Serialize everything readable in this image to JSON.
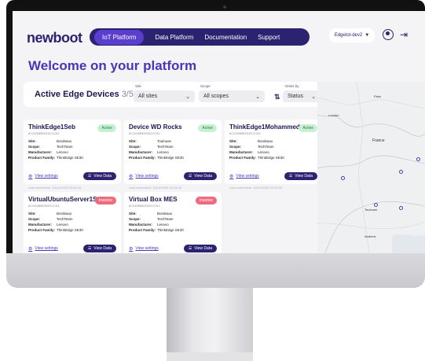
{
  "header": {
    "logo": "newboot",
    "nav": [
      "IoT Platform",
      "Data Platform",
      "Documentation",
      "Support"
    ],
    "env_select": "Edgelot-dev2",
    "env_chevron": "▼"
  },
  "welcome": "Welcome on your platform",
  "panel": {
    "title": "Active Edge Devices",
    "count": "3/5",
    "filters": {
      "site": {
        "label": "Site",
        "value": "All sites"
      },
      "scope": {
        "label": "Scope",
        "value": "All scopes"
      },
      "order": {
        "label": "Order by",
        "value": "Status"
      }
    }
  },
  "card_labels": {
    "site": "Site:",
    "scope": "Scope:",
    "manufacturer": "Manufacturer:",
    "product_family": "Product Family:",
    "view_settings": "View settings",
    "view_data": "View Data"
  },
  "devices": [
    {
      "name": "ThinkEdge1Seb",
      "id": "6C2409BEE03CCC51",
      "status": "Active",
      "site": "Bordeaux",
      "scope": "TechTeam",
      "manufacturer": "Lenovo",
      "product_family": "ThinkEdge SE30",
      "last_connection": "Last connection: 10/12/2023 20:19:43"
    },
    {
      "name": "Device WD Rocks",
      "id": "6C2409BEE03CCC51",
      "status": "Active",
      "site": "Toulouse",
      "scope": "TechTeam",
      "manufacturer": "Lenovo",
      "product_family": "ThinkEdge SE30",
      "last_connection": "Last connection: 10/12/2023 20:19:43"
    },
    {
      "name": "ThinkEdge1Mohammed",
      "id": "6C2409BEE03CCC51",
      "status": "Active",
      "site": "Bordeaux",
      "scope": "TechTeam",
      "manufacturer": "Lenovo",
      "product_family": "ThinkEdge SE30",
      "last_connection": "Last connection: 10/12/2023 20:19:43"
    },
    {
      "name": "VirtualUbuntuServer1Seb",
      "id": "6C2409BEE03CCC51",
      "status": "Inactive",
      "site": "Bordeaux",
      "scope": "TechTeam",
      "manufacturer": "Lenovo",
      "product_family": "ThinkEdge SE30"
    },
    {
      "name": "Virtual Box MES",
      "id": "6C2409BEE03CCC51",
      "status": "Inactive",
      "site": "Bordeaux",
      "scope": "TechTeam",
      "manufacturer": "Lenovo",
      "product_family": "ThinkEdge SE30"
    }
  ],
  "map": {
    "labels": [
      "Paris",
      "London",
      "France",
      "Toulouse",
      "Andorra"
    ]
  },
  "colors": {
    "brand": "#2c2370",
    "accent": "#4b34b8",
    "active_badge": "#c9f0d4",
    "inactive_badge": "#ef6a7c"
  },
  "icons": [
    "user-icon",
    "logout-icon",
    "gear-icon",
    "list-icon",
    "chevron-down-icon",
    "sort-icon",
    "map-pin-icon"
  ]
}
